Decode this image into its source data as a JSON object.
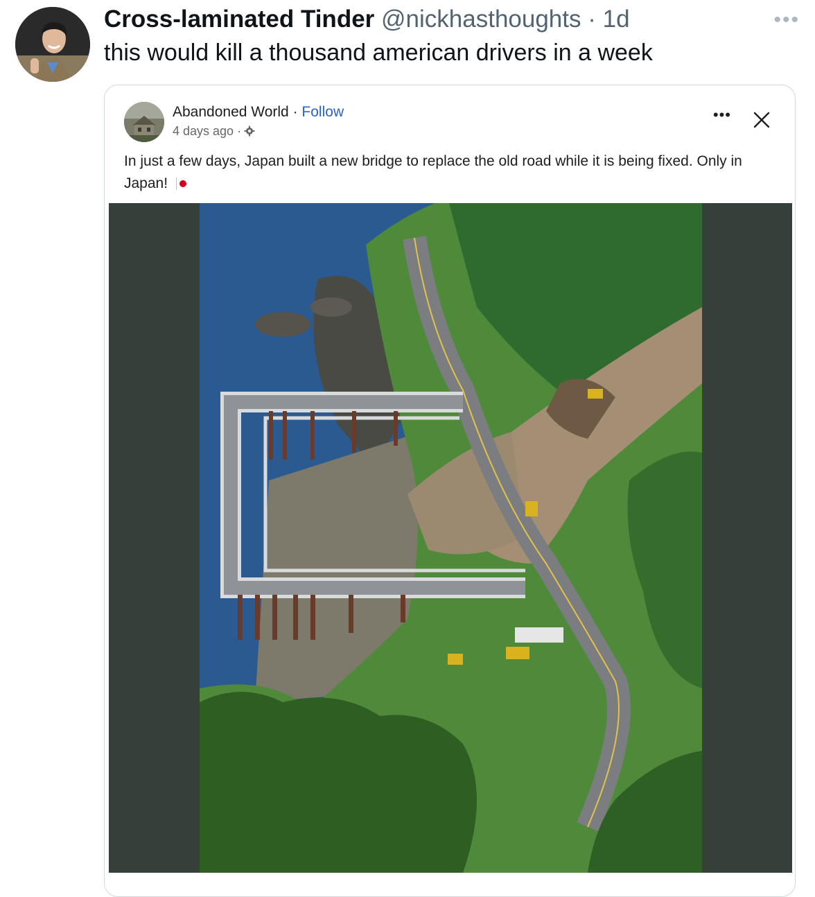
{
  "tweet": {
    "display_name": "Cross-laminated Tinder",
    "handle": "@nickhasthoughts",
    "separator": "·",
    "time": "1d",
    "text": "this would kill a thousand american drivers in a week",
    "more_icon": "ellipsis-icon"
  },
  "embedded_post": {
    "page_name": "Abandoned World",
    "separator": "·",
    "follow_label": "Follow",
    "time": "4 days ago ·",
    "audience_icon": "gear-icon",
    "more_icon": "ellipsis-icon",
    "close_icon": "close-icon",
    "body_text": "In just a few days, Japan built a new bridge to replace the old road while it is being fixed. Only in Japan!",
    "flag_icon": "japan-flag-icon"
  },
  "colors": {
    "handle_gray": "#536471",
    "link_blue": "#2d63c8",
    "photo_background": "#344039",
    "flag_red": "#d0021b"
  }
}
